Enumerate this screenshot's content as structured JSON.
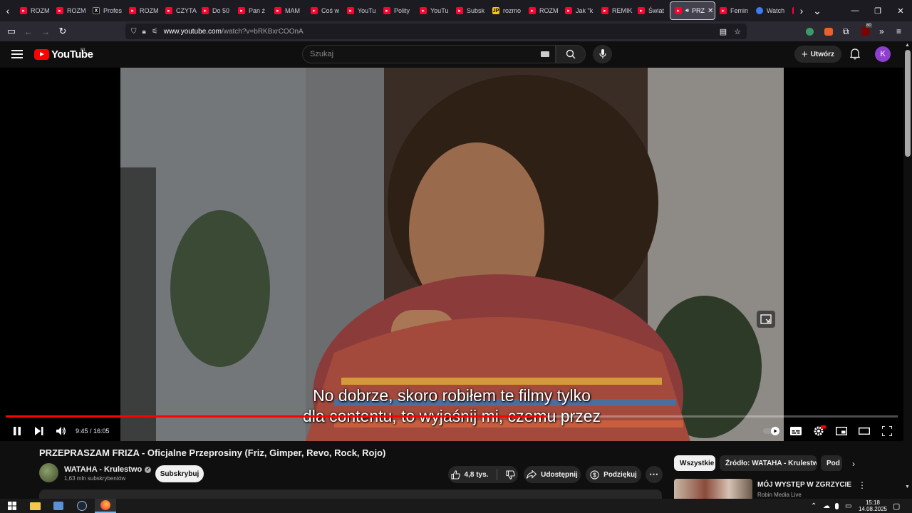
{
  "browser": {
    "tabs": [
      {
        "label": "ROZM",
        "favicon": "youtube-icon"
      },
      {
        "label": "ROZM",
        "favicon": "youtube-icon"
      },
      {
        "label": "Profes",
        "favicon": "x-icon"
      },
      {
        "label": "ROZM",
        "favicon": "youtube-icon"
      },
      {
        "label": "CZYTA",
        "favicon": "youtube-icon"
      },
      {
        "label": "Do 50",
        "favicon": "youtube-icon"
      },
      {
        "label": "Pan ż",
        "favicon": "youtube-icon"
      },
      {
        "label": "MAM",
        "favicon": "youtube-icon"
      },
      {
        "label": "Coś w",
        "favicon": "youtube-icon"
      },
      {
        "label": "YouTu",
        "favicon": "youtube-icon"
      },
      {
        "label": "Polity",
        "favicon": "youtube-icon"
      },
      {
        "label": "YouTu",
        "favicon": "youtube-icon"
      },
      {
        "label": "Subsk",
        "favicon": "youtube-icon"
      },
      {
        "label": "rozmo",
        "favicon": "jp-icon"
      },
      {
        "label": "ROZM",
        "favicon": "youtube-icon"
      },
      {
        "label": "Jak \"k",
        "favicon": "youtube-icon"
      },
      {
        "label": "REMIK",
        "favicon": "youtube-icon"
      },
      {
        "label": "Świat",
        "favicon": "youtube-icon"
      },
      {
        "label": "PRZ",
        "favicon": "youtube-icon",
        "active": true
      },
      {
        "label": "Femin",
        "favicon": "youtube-icon"
      },
      {
        "label": "Watch",
        "favicon": "ai-icon"
      },
      {
        "label": "",
        "favicon": "youtube-icon"
      }
    ],
    "url_host": "www.youtube.com",
    "url_path": "/watch?v=bRKBxrCOOnA",
    "extension_badge": "80"
  },
  "youtube": {
    "logo_text": "YouTube",
    "country_code": "PL",
    "search_placeholder": "Szukaj",
    "create_label": "Utwórz",
    "avatar_letter": "K"
  },
  "video": {
    "caption_line1": "No dobrze, skoro robiłem te filmy tylko",
    "caption_line2": "dla contentu, to wyjaśnij mi, czemu przez",
    "time_display": "9:45 / 16:05",
    "progress_fraction": 0.606,
    "title": "PRZEPRASZAM FRIZA - Oficjalne Przeprosiny (Friz, Gimper, Revo, Rock, Rojo)",
    "channel_name": "WATAHA - Krulestwo",
    "subscriber_count": "1,63 mln subskrybentów",
    "subscribe_label": "Subskrybuj",
    "like_count": "4,8 tys.",
    "share_label": "Udostępnij",
    "thanks_label": "Podziękuj"
  },
  "chips": [
    {
      "label": "Wszystkie",
      "active": true
    },
    {
      "label": "Źródło: WATAHA - Krulestwo",
      "active": false
    },
    {
      "label": "Pod",
      "active": false
    }
  ],
  "recommendation": {
    "title": "MÓJ WYSTĘP W ZGRZYCIE",
    "channel": "Robin Media Live"
  },
  "taskbar": {
    "time": "15:18",
    "date": "14.08.2025"
  },
  "colors": {
    "accent_red": "#ff0000",
    "avatar_purple": "#8e3fcf",
    "background": "#0f0f0f"
  }
}
